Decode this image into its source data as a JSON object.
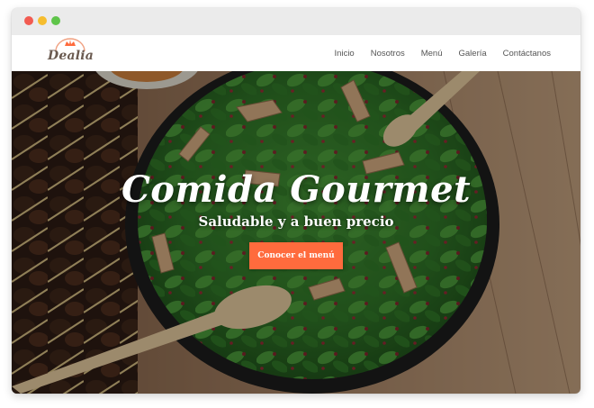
{
  "brand": {
    "name": "Dealia",
    "accent": "#ff6b3d"
  },
  "nav": {
    "items": [
      {
        "label": "Inicio"
      },
      {
        "label": "Nosotros"
      },
      {
        "label": "Menú"
      },
      {
        "label": "Galería"
      },
      {
        "label": "Contáctanos"
      }
    ]
  },
  "hero": {
    "title": "Comida Gourmet",
    "subtitle": "Saludable y a buen precio",
    "cta_label": "Conocer el menú",
    "image": "salad-bowl-photo"
  },
  "window": {
    "controls": [
      "close",
      "minimize",
      "maximize"
    ]
  }
}
